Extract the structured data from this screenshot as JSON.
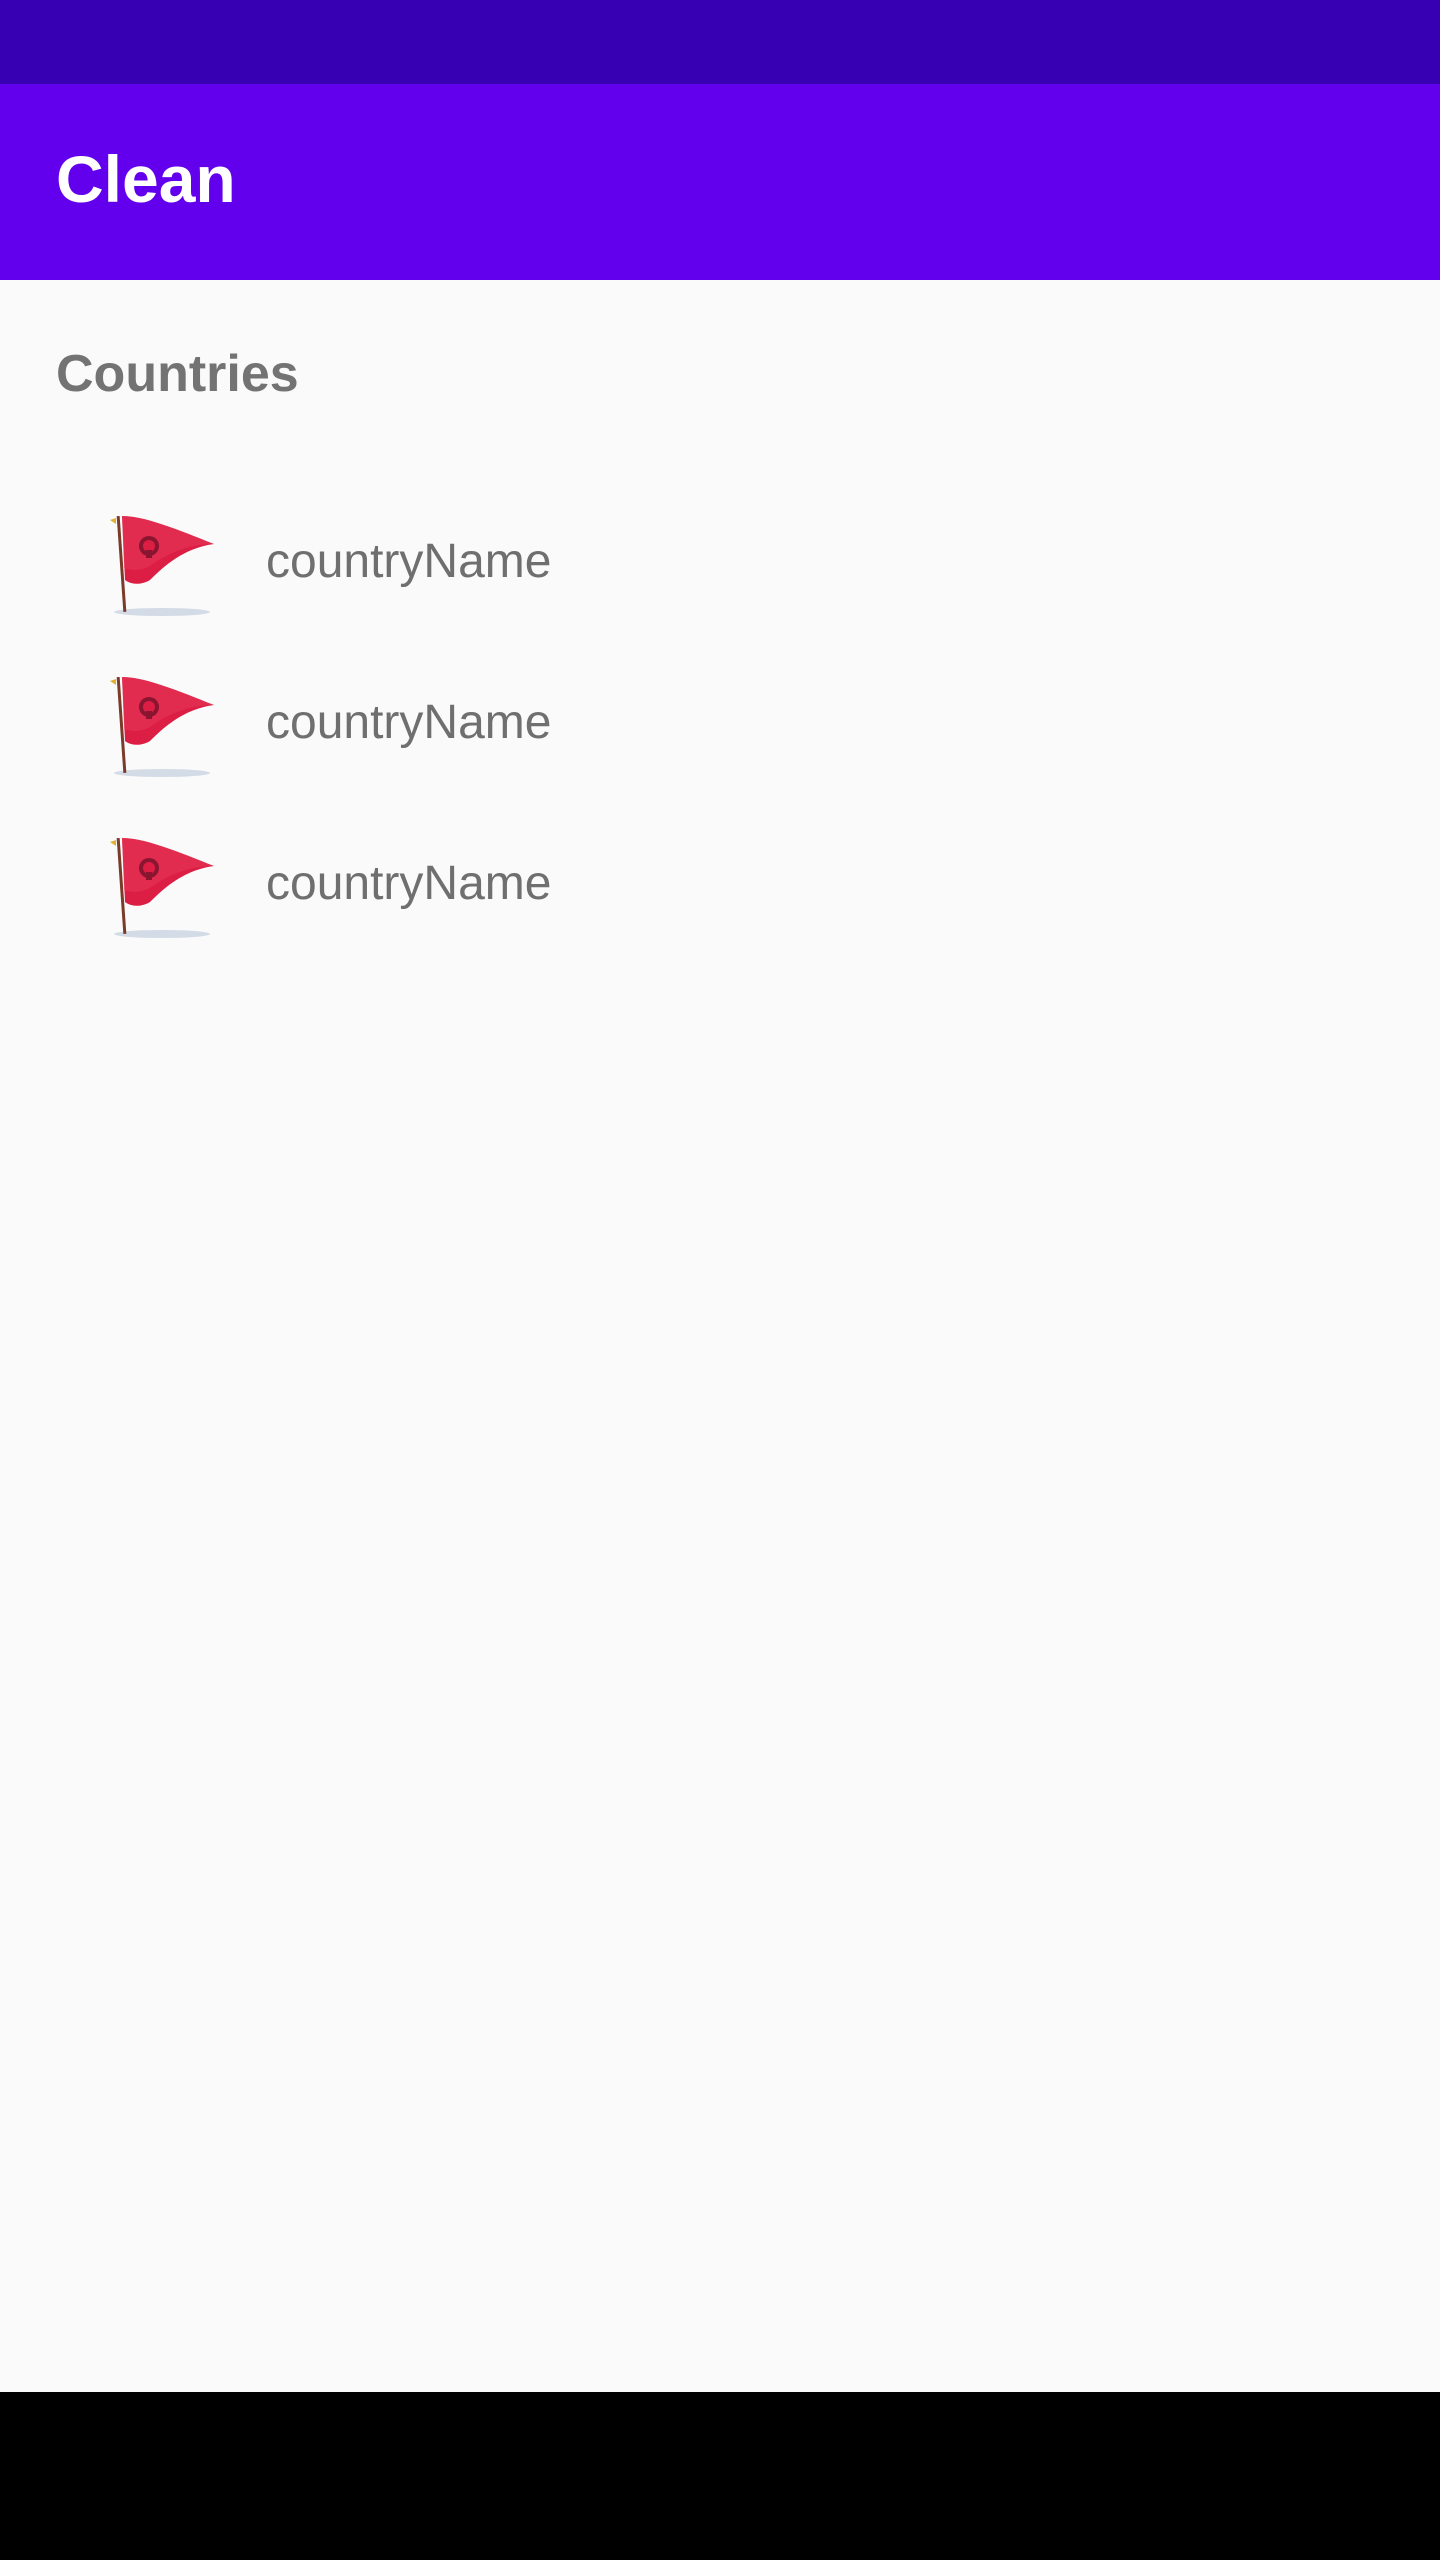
{
  "app": {
    "title": "Clean"
  },
  "colors": {
    "status_bar": "#3700b3",
    "app_bar": "#6200ee",
    "background": "#fafafa",
    "flag_red": "#dc1e44",
    "nav_bar": "#000000"
  },
  "main": {
    "section_title": "Countries",
    "items": [
      {
        "label": "countryName",
        "icon": "github-flag-icon"
      },
      {
        "label": "countryName",
        "icon": "github-flag-icon"
      },
      {
        "label": "countryName",
        "icon": "github-flag-icon"
      }
    ]
  }
}
